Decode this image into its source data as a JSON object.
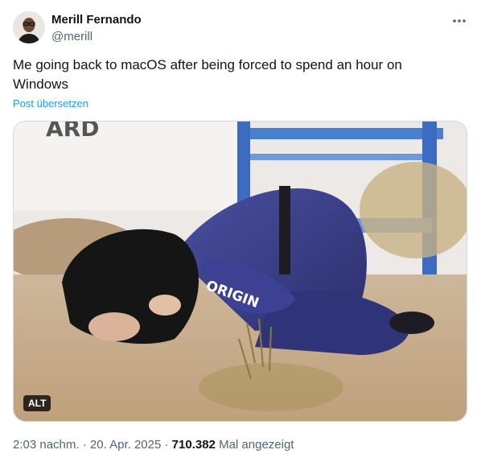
{
  "author": {
    "name": "Merill Fernando",
    "handle": "@merill"
  },
  "tweet": {
    "text": "Me going back to macOS after being forced to spend an hour on Windows",
    "translate_label": "Post übersetzen"
  },
  "media": {
    "alt_badge": "ALT",
    "suit_text": "ORIGIN",
    "sign_text": "ARD"
  },
  "meta": {
    "time": "2:03 nachm.",
    "sep1": "·",
    "date": "20. Apr. 2025",
    "sep2": "·",
    "views_count": "710.382",
    "views_label": "Mal angezeigt"
  },
  "icons": {
    "more": "more-horizontal-icon"
  },
  "colors": {
    "accent": "#1d9bf0",
    "secondary_text": "#536471",
    "primary_text": "#0f1419"
  }
}
